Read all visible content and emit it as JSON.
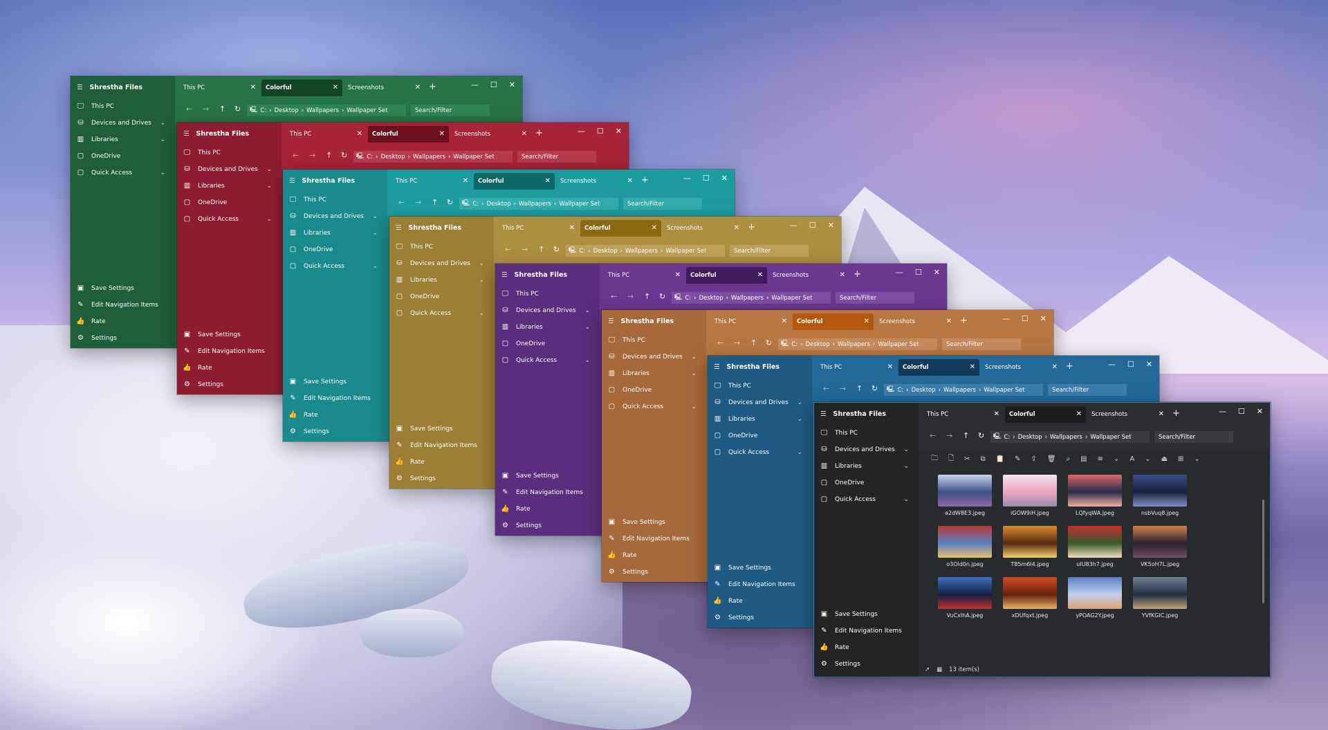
{
  "app_name": "Shrestha Files",
  "nav": [
    {
      "label": "This PC",
      "icon": "monitor-icon",
      "chevron": false
    },
    {
      "label": "Devices and Drives",
      "icon": "drives-icon",
      "chevron": true
    },
    {
      "label": "Libraries",
      "icon": "libraries-icon",
      "chevron": true
    },
    {
      "label": "OneDrive",
      "icon": "onedrive-icon",
      "chevron": false
    },
    {
      "label": "Quick Access",
      "icon": "quick-access-icon",
      "chevron": true
    }
  ],
  "bottom_nav": [
    {
      "label": "Save Settings",
      "icon": "save-icon"
    },
    {
      "label": "Edit Navigation Items",
      "icon": "pencil-icon"
    },
    {
      "label": "Rate",
      "icon": "thumbs-up-icon"
    },
    {
      "label": "Settings",
      "icon": "gear-icon"
    }
  ],
  "tabs": [
    {
      "label": "This PC",
      "active": false
    },
    {
      "label": "Colorful",
      "active": true
    },
    {
      "label": "Screenshots",
      "active": false
    }
  ],
  "address": {
    "drive": "C:",
    "parts": [
      "Desktop",
      "Wallpapers",
      "Wallpaper Set"
    ]
  },
  "search_placeholder": "Search/Filter",
  "themes": [
    {
      "name": "green",
      "accent": "#1f5e3a"
    },
    {
      "name": "red",
      "accent": "#8e1d31"
    },
    {
      "name": "teal",
      "accent": "#1b8a8c"
    },
    {
      "name": "gold",
      "accent": "#9c7f35"
    },
    {
      "name": "purple",
      "accent": "#5a2e7e"
    },
    {
      "name": "orange",
      "accent": "#a8693a"
    },
    {
      "name": "blue",
      "accent": "#1f5a84"
    },
    {
      "name": "dark",
      "accent": "#222526"
    }
  ],
  "files": [
    {
      "name": "a2dW8E3.jpeg",
      "colors": [
        "#3f4f86",
        "#c9d3ea",
        "#8e6aa4"
      ]
    },
    {
      "name": "iGOW9iH.jpeg",
      "colors": [
        "#e9a6c2",
        "#f6e3ea",
        "#9b8ba8"
      ]
    },
    {
      "name": "LQfyqWA.jpeg",
      "colors": [
        "#2b2b4a",
        "#d86a6a",
        "#f0b0a0"
      ]
    },
    {
      "name": "nsbVuq8.jpeg",
      "colors": [
        "#1a1f3c",
        "#3c4e86",
        "#8090c8"
      ]
    },
    {
      "name": "o3Old0n.jpeg",
      "colors": [
        "#5d7fc0",
        "#b73a3a",
        "#e8c070"
      ]
    },
    {
      "name": "T85m6l4.jpeg",
      "colors": [
        "#5a2a10",
        "#d88a30",
        "#f0d070"
      ]
    },
    {
      "name": "uIU83h7.jpeg",
      "colors": [
        "#3a5a2a",
        "#c23030",
        "#f0e0c0"
      ]
    },
    {
      "name": "VK5oH7L.jpeg",
      "colors": [
        "#2a2030",
        "#d08050",
        "#705060"
      ]
    },
    {
      "name": "VuCxlhA.jpeg",
      "colors": [
        "#102040",
        "#4070c0",
        "#c03030"
      ]
    },
    {
      "name": "xDUfqxt.jpeg",
      "colors": [
        "#6a2010",
        "#d04a20",
        "#e8b060"
      ]
    },
    {
      "name": "yPOAG2Y.jpeg",
      "colors": [
        "#c0d0f0",
        "#5a80c0",
        "#e0a070"
      ]
    },
    {
      "name": "YVfKGIC.jpeg",
      "colors": [
        "#203040",
        "#708090",
        "#c0a080"
      ]
    }
  ],
  "status": {
    "count": "13 item(s)"
  }
}
